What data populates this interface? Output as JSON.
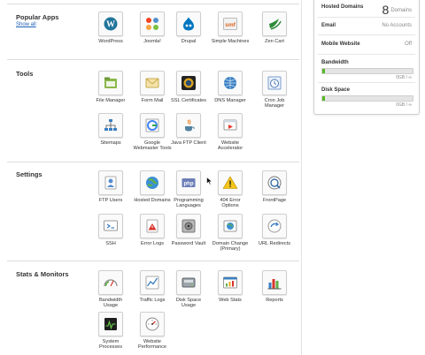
{
  "sections": {
    "popular": {
      "title": "Popular Apps",
      "show_all": "Show all"
    },
    "tools": {
      "title": "Tools"
    },
    "settings": {
      "title": "Settings"
    },
    "stats": {
      "title": "Stats & Monitors"
    }
  },
  "popular_apps": [
    {
      "label": "WordPress",
      "icon": "wordpress-icon"
    },
    {
      "label": "Joomla!",
      "icon": "joomla-icon"
    },
    {
      "label": "Drupal",
      "icon": "drupal-icon"
    },
    {
      "label": "Simple Machines",
      "icon": "smf-icon"
    },
    {
      "label": "Zen Cart",
      "icon": "zen-cart-icon"
    }
  ],
  "tools": [
    {
      "label": "File Manager",
      "icon": "file-manager-icon"
    },
    {
      "label": "Form Mail",
      "icon": "form-mail-icon"
    },
    {
      "label": "SSL Certificates",
      "icon": "ssl-certificates-icon"
    },
    {
      "label": "DNS Manager",
      "icon": "dns-manager-icon"
    },
    {
      "label": "Cron Job\nManager",
      "icon": "cron-job-icon"
    },
    {
      "label": "Sitemaps",
      "icon": "sitemaps-icon"
    },
    {
      "label": "Google\nWebmaster Tools",
      "icon": "google-webmaster-icon"
    },
    {
      "label": "Java FTP Client",
      "icon": "java-ftp-icon"
    },
    {
      "label": "Website\nAccelerator",
      "icon": "website-accelerator-icon"
    }
  ],
  "settings": [
    {
      "label": "FTP Users",
      "icon": "ftp-users-icon"
    },
    {
      "label": "Hosted Domains",
      "icon": "hosted-domains-icon"
    },
    {
      "label": "Programming\nLanguages",
      "icon": "programming-languages-icon"
    },
    {
      "label": "404 Error\nOptions",
      "icon": "error-404-icon"
    },
    {
      "label": "FrontPage",
      "icon": "frontpage-icon"
    },
    {
      "label": "SSH",
      "icon": "ssh-icon"
    },
    {
      "label": "Error Logs",
      "icon": "error-logs-icon"
    },
    {
      "label": "Password Vault",
      "icon": "password-vault-icon"
    },
    {
      "label": "Domain Change\n(Primary)",
      "icon": "domain-change-icon"
    },
    {
      "label": "URL Redirects",
      "icon": "url-redirects-icon"
    }
  ],
  "stats": [
    {
      "label": "Bandwidth\nUsage",
      "icon": "bandwidth-usage-icon"
    },
    {
      "label": "Traffic Logs",
      "icon": "traffic-logs-icon"
    },
    {
      "label": "Disk Space\nUsage",
      "icon": "disk-space-usage-icon"
    },
    {
      "label": "Web Stats",
      "icon": "web-stats-icon"
    },
    {
      "label": "Reports",
      "icon": "reports-icon"
    },
    {
      "label": "System\nProcesses",
      "icon": "system-processes-icon"
    },
    {
      "label": "Website\nPerformance",
      "icon": "website-performance-icon"
    }
  ],
  "account": {
    "hosted_domains_label": "Hosted Domains",
    "hosted_domains_count": "8",
    "hosted_domains_unit": "Domains",
    "email_label": "Email",
    "email_value": "No Accounts",
    "mobile_label": "Mobile Website",
    "mobile_value": "Off",
    "bandwidth_label": "Bandwidth",
    "bandwidth_value": "0GB / ∞",
    "bandwidth_fraction": 0.03,
    "disk_label": "Disk Space",
    "disk_value": "0GB / ∞",
    "disk_fraction": 0.03
  },
  "colors": {
    "bar_fill": "#58b828",
    "link": "#1a5fb4"
  }
}
